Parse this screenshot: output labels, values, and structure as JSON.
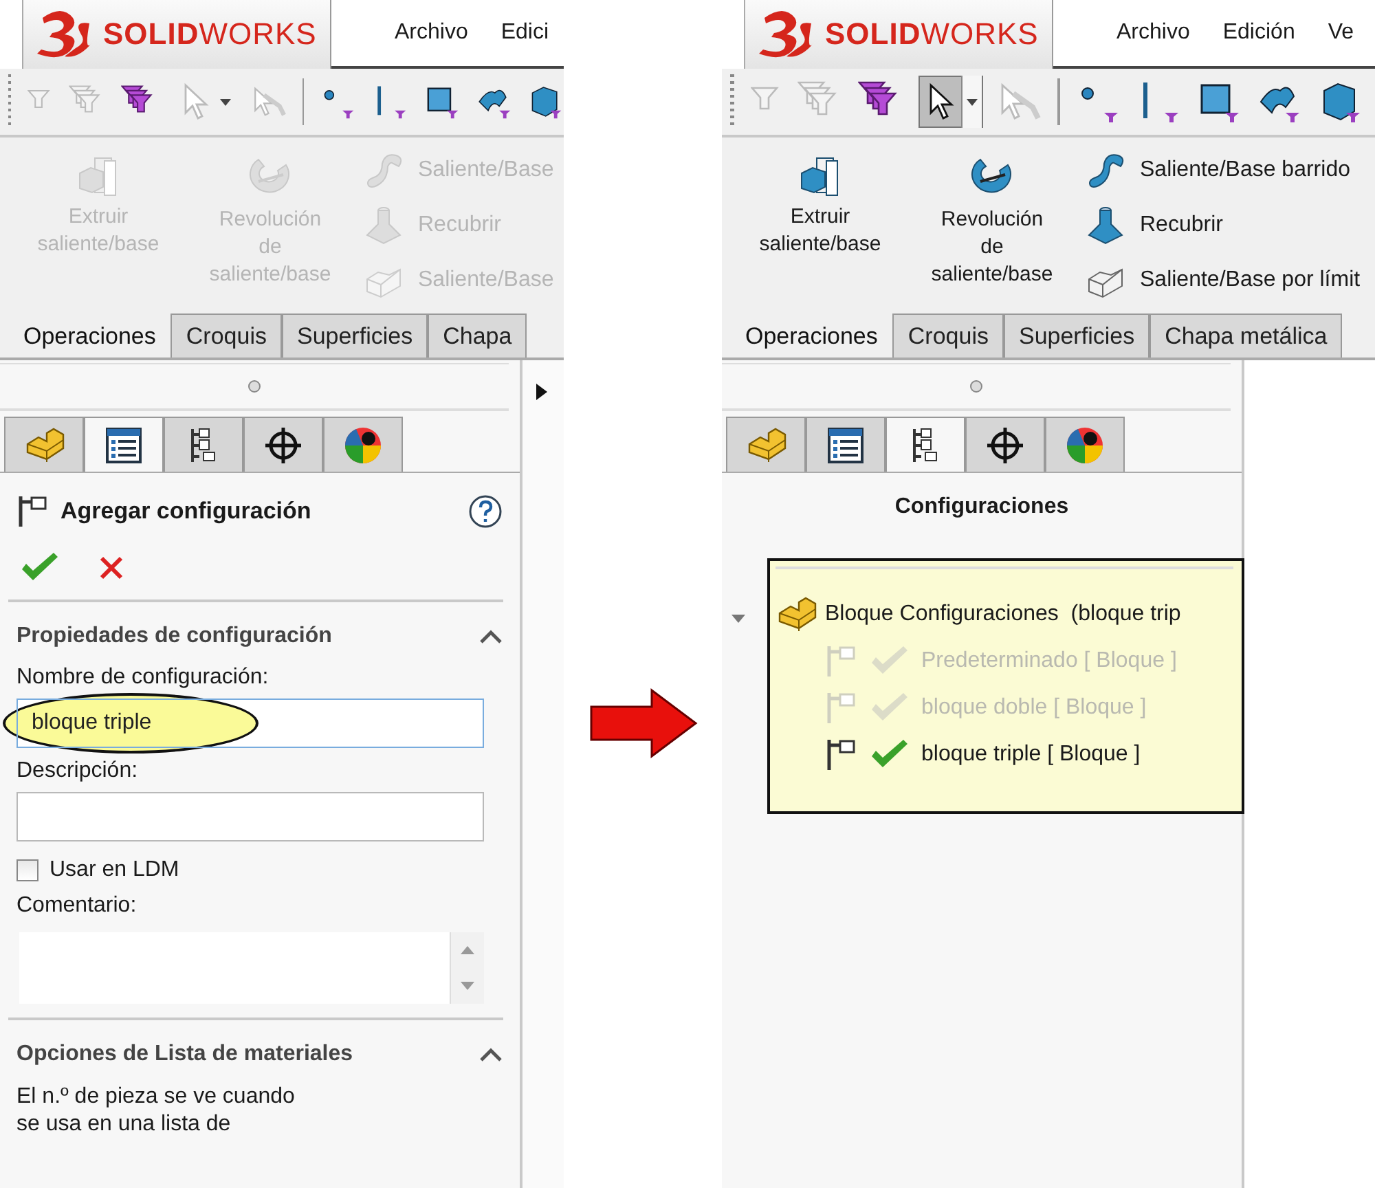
{
  "panels": [
    {
      "kind": "property_manager",
      "logo": "**SOLID**WORKS",
      "menu": [
        "Archivo",
        "Edici"
      ],
      "select_pressed": false,
      "commands_enabled": false,
      "large_commands": [
        "Extruir\nsaliente/base",
        "Revolución\nde\nsaliente/base"
      ],
      "small_commands": [
        "Saliente/Base",
        "Recubrir",
        "Saliente/Base"
      ],
      "tabs": [
        {
          "label": "Operaciones",
          "selected": true
        },
        {
          "label": "Croquis",
          "selected": false
        },
        {
          "label": "Superficies",
          "selected": false
        },
        {
          "label": "Chapa",
          "selected": false
        }
      ],
      "pane_tabs": [
        {
          "selected": false
        },
        {
          "selected": true
        },
        {
          "selected": false
        },
        {
          "selected": false
        },
        {
          "selected": false
        }
      ],
      "graphics_expander": true,
      "property_manager": {
        "title": "Agregar configuración",
        "sections": [
          {
            "title": "Propiedades de configuración",
            "expanded": true,
            "fields": [
              {
                "kind": "text",
                "label": "Nombre de configuración:",
                "value": "bloque triple",
                "focused": true,
                "highlighted": true
              },
              {
                "kind": "text",
                "label": "Descripción:",
                "focused": false,
                "highlighted": false
              },
              {
                "kind": "checkbox",
                "label": "Usar en LDM",
                "checked": false
              },
              {
                "kind": "textarea",
                "label": "Comentario:"
              }
            ]
          },
          {
            "title": "Opciones de Lista de materiales",
            "expanded": true,
            "note": "El n.º de pieza se ve cuando\nse usa en una lista de"
          }
        ]
      }
    },
    {
      "kind": "configuration_manager",
      "logo": "**SOLID**WORKS",
      "menu": [
        "Archivo",
        "Edición",
        "Ve"
      ],
      "select_pressed": true,
      "commands_enabled": true,
      "large_commands": [
        "Extruir\nsaliente/base",
        "Revolución\nde\nsaliente/base"
      ],
      "small_commands": [
        "Saliente/Base barrido",
        "Recubrir",
        "Saliente/Base por límit"
      ],
      "tabs": [
        {
          "label": "Operaciones",
          "selected": true
        },
        {
          "label": "Croquis",
          "selected": false
        },
        {
          "label": "Superficies",
          "selected": false
        },
        {
          "label": "Chapa metálica",
          "selected": false
        }
      ],
      "pane_tabs": [
        {
          "selected": false
        },
        {
          "selected": false
        },
        {
          "selected": true
        },
        {
          "selected": false
        },
        {
          "selected": false
        }
      ],
      "graphics_expander": false,
      "configuration_manager": {
        "title": "Configuraciones",
        "highlighted": true,
        "root": {
          "label": "Bloque Configuraciones  (bloque trip",
          "expanded": true,
          "children": [
            {
              "label": "Predeterminado [ Bloque ]",
              "active": false
            },
            {
              "label": "bloque doble [ Bloque ]",
              "active": false
            },
            {
              "label": "bloque triple [ Bloque ]",
              "active": true
            }
          ]
        }
      }
    }
  ]
}
